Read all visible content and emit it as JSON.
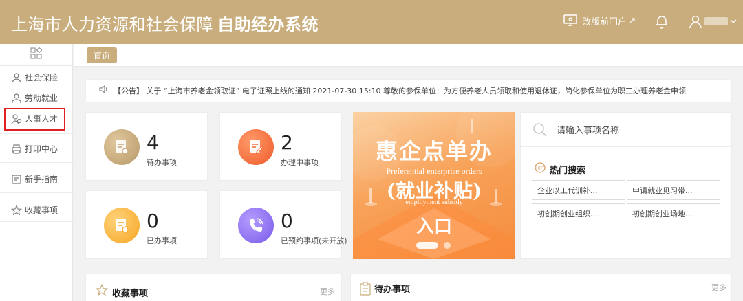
{
  "header": {
    "title_prefix": "上海市人力资源和社会保障",
    "title_bold": "自助经办系统",
    "old_portal_label": "改版前门户",
    "bg_color": "#c9ad7c"
  },
  "sidebar": {
    "items": [
      {
        "label": "社会保险",
        "icon": "social-insurance-icon"
      },
      {
        "label": "劳动就业",
        "icon": "employment-icon"
      },
      {
        "label": "人事人才",
        "icon": "talent-icon"
      },
      {
        "label": "打印中心",
        "icon": "printer-icon"
      },
      {
        "label": "新手指南",
        "icon": "guide-icon"
      },
      {
        "label": "收藏事项",
        "icon": "star-icon"
      }
    ]
  },
  "tabs": {
    "home": "首页"
  },
  "notice": {
    "text": "【公告】 关于 “上海市养老金领取证” 电子证照上线的通知 2021-07-30 15:10 尊敬的参保单位：为方便养老人员领取和使用退休证，简化参保单位为职工办理养老金申领"
  },
  "stats": [
    {
      "value": "4",
      "label": "待办事项",
      "color": "#c9ad7c"
    },
    {
      "value": "2",
      "label": "办理中事项",
      "color": "#f26b3a"
    },
    {
      "value": "0",
      "label": "已办事项",
      "color": "#f5a623"
    },
    {
      "value": "0",
      "label": "已预约事项(未开放)",
      "color": "#8c6cf0"
    }
  ],
  "banner": {
    "title": "惠企点单办",
    "subtitle_en": "Preferential enterprise orders",
    "title2": "(就业补贴)",
    "subtitle2_en": "employment subsidy",
    "entry": "入口"
  },
  "search": {
    "placeholder": "请输入事项名称",
    "hot_title": "热门搜索",
    "hot_items": [
      "企业以工代训补...",
      "申请就业见习带...",
      "初创期创业组织...",
      "初创期创业场地..."
    ]
  },
  "panels": {
    "favorites": {
      "title": "收藏事项",
      "more": "更多"
    },
    "todo": {
      "title": "待办事项",
      "more": "更多"
    }
  }
}
